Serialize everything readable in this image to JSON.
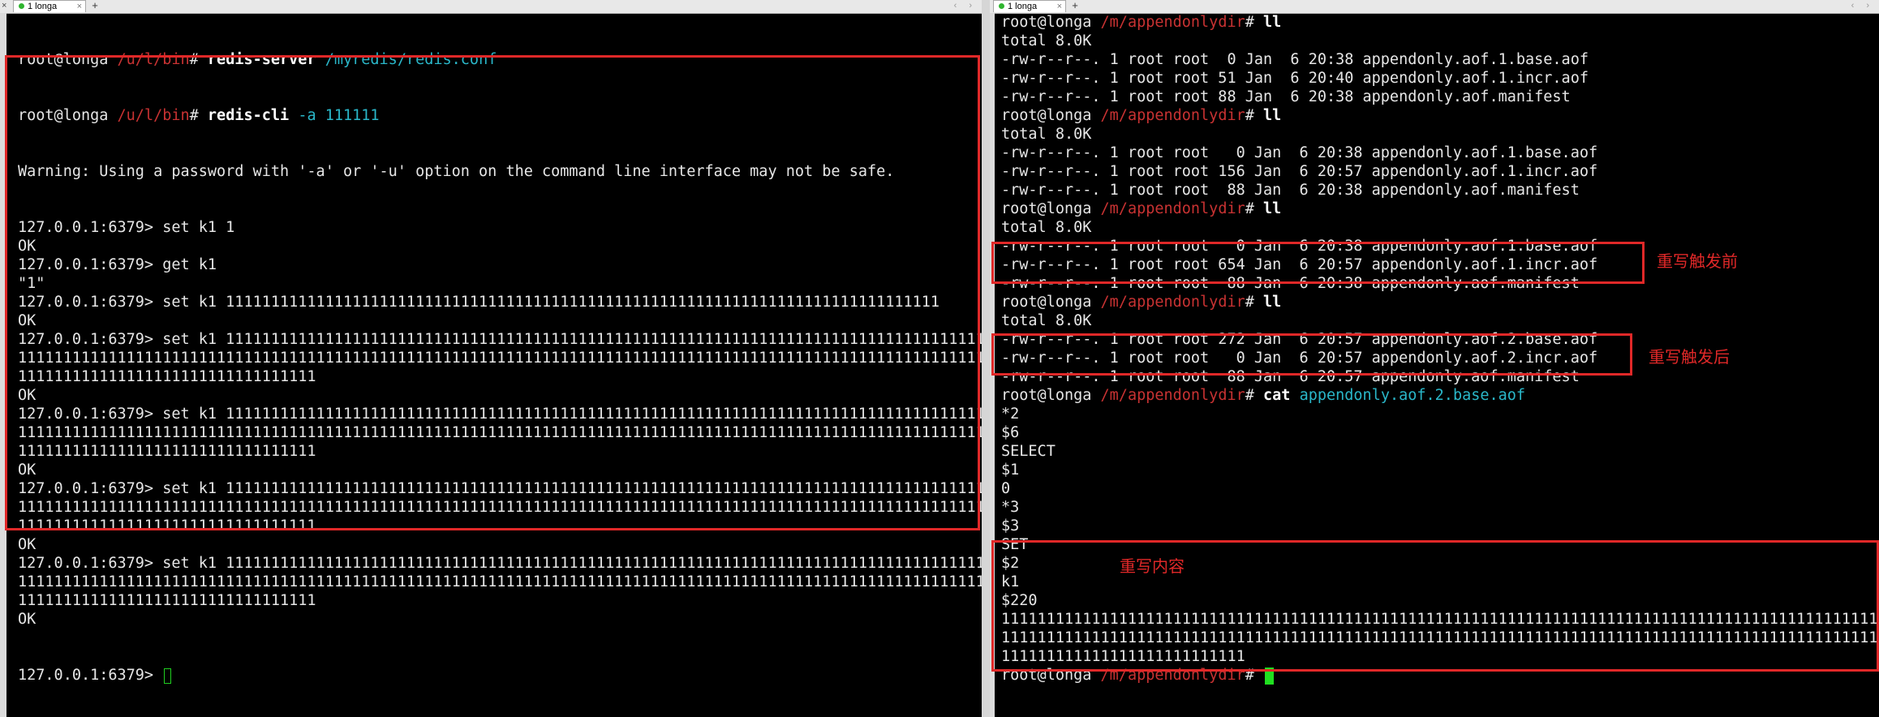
{
  "tabs": {
    "left_label": "1 longa",
    "right_label": "1 longa",
    "close_glyph": "×",
    "add_glyph": "+",
    "nav_glyph": "‹ ›"
  },
  "left_terminal": {
    "line1": {
      "prompt": "root@longa",
      "path": "/u/l/bin",
      "hash": "#",
      "cmd": "redis-server",
      "arg": "/myredis/redis.conf"
    },
    "line2": {
      "prompt": "root@longa",
      "path": "/u/l/bin",
      "hash": "#",
      "cmd": "redis-cli",
      "arg": "-a 111111"
    },
    "warning": "Warning: Using a password with '-a' or '-u' option on the command line interface may not be safe.",
    "lines": [
      "127.0.0.1:6379> set k1 1",
      "OK",
      "127.0.0.1:6379> get k1",
      "\"1\"",
      "127.0.0.1:6379> set k1 1111111111111111111111111111111111111111111111111111111111111111111111111111111",
      "OK",
      "127.0.0.1:6379> set k1 11111111111111111111111111111111111111111111111111111111111111111111111111111111111111111111111",
      "11111111111111111111111111111111111111111111111111111111111111111111111111111111111111111111111111111111111111",
      "111111111111111111111111111111111",
      "OK",
      "127.0.0.1:6379> set k1 11111111111111111111111111111111111111111111111111111111111111111111111111111111111111111111111",
      "11111111111111111111111111111111111111111111111111111111111111111111111111111111111111111111111111111111111111",
      "111111111111111111111111111111111",
      "OK",
      "127.0.0.1:6379> set k1 11111111111111111111111111111111111111111111111111111111111111111111111111111111111111111111111",
      "11111111111111111111111111111111111111111111111111111111111111111111111111111111111111111111111111111111111111",
      "111111111111111111111111111111111",
      "OK",
      "127.0.0.1:6379> set k1 11111111111111111111111111111111111111111111111111111111111111111111111111111111111111111111111",
      "11111111111111111111111111111111111111111111111111111111111111111111111111111111111111111111111111111111111111",
      "111111111111111111111111111111111",
      "OK"
    ],
    "final_prompt": "127.0.0.1:6379> "
  },
  "right_terminal": {
    "prompt": "root@longa",
    "path": "/m/appendonlydir",
    "hash": "#",
    "ll_cmd": "ll",
    "total": "total 8.0K",
    "listing1": [
      "-rw-r--r--. 1 root root  0 Jan  6 20:38 appendonly.aof.1.base.aof",
      "-rw-r--r--. 1 root root 51 Jan  6 20:40 appendonly.aof.1.incr.aof",
      "-rw-r--r--. 1 root root 88 Jan  6 20:38 appendonly.aof.manifest"
    ],
    "listing2": [
      "-rw-r--r--. 1 root root   0 Jan  6 20:38 appendonly.aof.1.base.aof",
      "-rw-r--r--. 1 root root 156 Jan  6 20:57 appendonly.aof.1.incr.aof",
      "-rw-r--r--. 1 root root  88 Jan  6 20:38 appendonly.aof.manifest"
    ],
    "listing3": [
      "-rw-r--r--. 1 root root   0 Jan  6 20:38 appendonly.aof.1.base.aof",
      "-rw-r--r--. 1 root root 654 Jan  6 20:57 appendonly.aof.1.incr.aof",
      "-rw-r--r--. 1 root root  88 Jan  6 20:38 appendonly.aof.manifest"
    ],
    "listing4": [
      "-rw-r--r--. 1 root root 272 Jan  6 20:57 appendonly.aof.2.base.aof",
      "-rw-r--r--. 1 root root   0 Jan  6 20:57 appendonly.aof.2.incr.aof",
      "-rw-r--r--. 1 root root  88 Jan  6 20:57 appendonly.aof.manifest"
    ],
    "cat_cmd": "cat",
    "cat_arg": "appendonly.aof.2.base.aof",
    "cat_lines": [
      "*2",
      "$6",
      "SELECT",
      "$1",
      "0",
      "*3",
      "$3",
      "SET",
      "$2",
      "k1",
      "$220",
      "1111111111111111111111111111111111111111111111111111111111111111111111111111111111111111111111111",
      "1111111111111111111111111111111111111111111111111111111111111111111111111111111111111111111111111",
      "111111111111111111111111111"
    ]
  },
  "annotations": {
    "before_rewrite": "重写触发前",
    "after_rewrite": "重写触发后",
    "rewrite_content": "重写内容"
  },
  "colors": {
    "annotation": "#e02828",
    "path": "#c83232",
    "arg": "#2ab7c9",
    "cursor": "#20e020"
  }
}
